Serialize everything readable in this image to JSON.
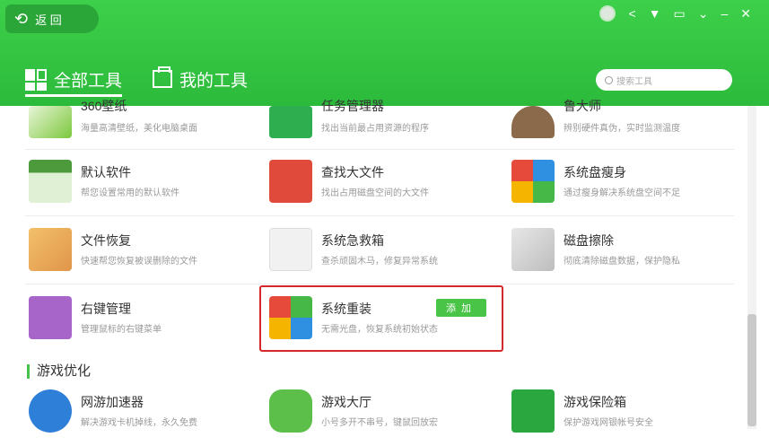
{
  "header": {
    "back_label": "返 回",
    "tabs": [
      {
        "label": "全部工具",
        "active": true
      },
      {
        "label": "我的工具",
        "active": false
      }
    ],
    "search_placeholder": "搜索工具",
    "window_controls": [
      "avatar-icon",
      "share-icon",
      "skin-icon",
      "menu-icon",
      "dropdown-icon",
      "minimize-icon",
      "close-icon"
    ]
  },
  "tools": {
    "r0": [
      {
        "name": "360壁纸",
        "desc": "海量高清壁纸，美化电脑桌面",
        "icon": "wallpaper-icon"
      },
      {
        "name": "任务管理器",
        "desc": "找出当前最占用资源的程序",
        "icon": "task-manager-icon"
      },
      {
        "name": "鲁大师",
        "desc": "辨别硬件真伪，实时监测温度",
        "icon": "ludashi-icon"
      }
    ],
    "r1": [
      {
        "name": "默认软件",
        "desc": "帮您设置常用的默认软件",
        "icon": "default-software-icon"
      },
      {
        "name": "查找大文件",
        "desc": "找出占用磁盘空间的大文件",
        "icon": "big-file-icon"
      },
      {
        "name": "系统盘瘦身",
        "desc": "通过瘦身解决系统盘空间不足",
        "icon": "disk-slim-icon"
      }
    ],
    "r2": [
      {
        "name": "文件恢复",
        "desc": "快速帮您恢复被误删除的文件",
        "icon": "file-recovery-icon"
      },
      {
        "name": "系统急救箱",
        "desc": "查杀顽固木马，修复异常系统",
        "icon": "first-aid-icon"
      },
      {
        "name": "磁盘擦除",
        "desc": "彻底清除磁盘数据，保护隐私",
        "icon": "disk-erase-icon"
      }
    ],
    "r3": [
      {
        "name": "右键管理",
        "desc": "管理鼠标的右键菜单",
        "icon": "mouse-icon"
      },
      {
        "name": "系统重装",
        "desc": "无需光盘，恢复系统初始状态",
        "icon": "system-reinstall-icon",
        "add_label": "添加"
      }
    ]
  },
  "games_section": {
    "title": "游戏优化",
    "tools": [
      {
        "name": "网游加速器",
        "desc": "解决游戏卡机掉线，永久免费",
        "icon": "game-accelerator-icon"
      },
      {
        "name": "游戏大厅",
        "desc": "小号多开不串号，键鼠回放宏",
        "icon": "game-hall-icon"
      },
      {
        "name": "游戏保险箱",
        "desc": "保护游戏网银帐号安全",
        "icon": "game-safe-icon"
      }
    ]
  },
  "colors": {
    "brand_green": "#2cba3b",
    "highlight_red": "#d62828",
    "add_button": "#49c447"
  }
}
